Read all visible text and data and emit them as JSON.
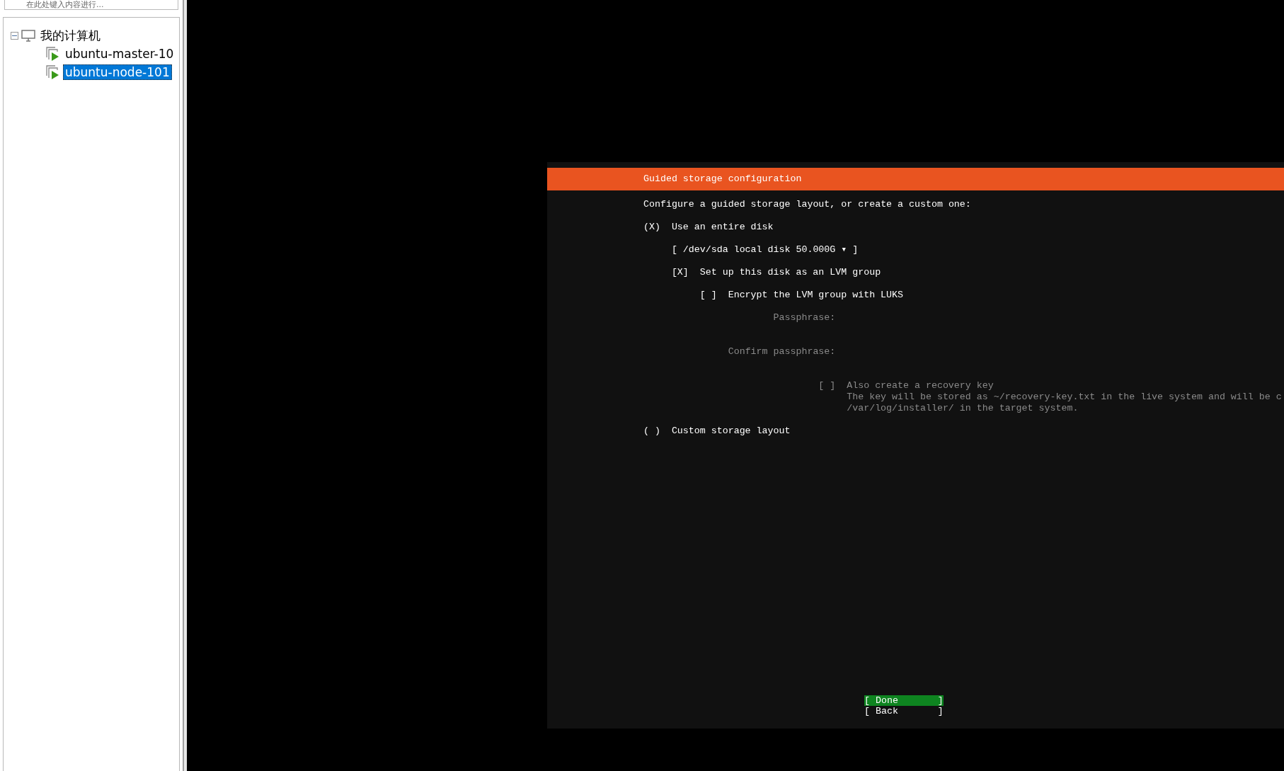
{
  "sidebar": {
    "search": {
      "placeholder": "在此处键入内容进行..."
    },
    "tree": [
      {
        "label": "我的计算机",
        "expanded": true,
        "selected": false,
        "children": [
          {
            "label": "ubuntu-master-10",
            "selected": false
          },
          {
            "label": "ubuntu-node-101",
            "selected": true
          }
        ]
      }
    ]
  },
  "installer": {
    "title": "Guided storage configuration",
    "prompt": "Configure a guided storage layout, or create a custom one:",
    "items": [
      {
        "kind": "radio",
        "marker": "(X)",
        "label": "Use an entire disk",
        "disabled": false,
        "children": [
          {
            "kind": "dropdown",
            "label": "[ /dev/sda local disk 50.000G ▾ ]",
            "disabled": false
          },
          {
            "kind": "checkbox",
            "marker": "[X]",
            "label": "Set up this disk as an LVM group",
            "disabled": false,
            "children": [
              {
                "kind": "checkbox",
                "marker": "[ ]",
                "label": "Encrypt the LVM group with LUKS",
                "disabled": false,
                "children": [
                  {
                    "kind": "field",
                    "label": "Passphrase:",
                    "disabled": true
                  },
                  {
                    "kind": "field",
                    "label": "Confirm passphrase:",
                    "disabled": true
                  },
                  {
                    "kind": "checkbox",
                    "marker": "[ ]",
                    "label": "Also create a recovery key",
                    "disabled": true,
                    "description": [
                      "The key will be stored as ~/recovery-key.txt in the live system and will be c",
                      "/var/log/installer/ in the target system."
                    ]
                  }
                ]
              }
            ]
          }
        ]
      },
      {
        "kind": "radio",
        "marker": "( )",
        "label": "Custom storage layout",
        "disabled": false
      }
    ],
    "buttons": [
      {
        "label": "[ Done       ]",
        "selected": true
      },
      {
        "label": "[ Back       ]",
        "selected": false
      }
    ]
  }
}
